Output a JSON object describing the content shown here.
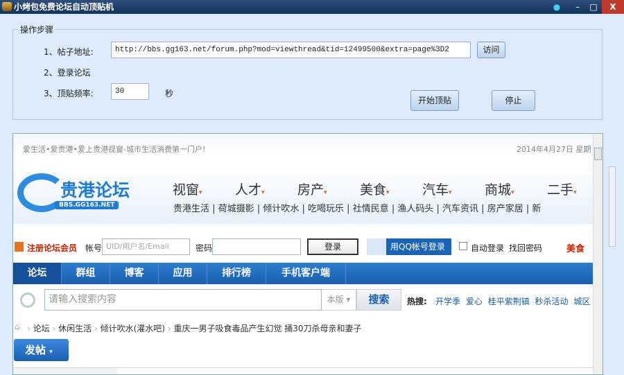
{
  "window": {
    "title": "小烤包免费论坛自动顶贴机",
    "min": "–",
    "max": "□",
    "close": "X"
  },
  "steps": {
    "group_title": "操作步骤",
    "step1_label": "1、帖子地址:",
    "url": "http://bbs.gg163.net/forum.php?mod=viewthread&tid=12499500&extra=page%3D2",
    "visit": "访问",
    "step2_label": "2、登录论坛",
    "step3_label": "3、顶贴频率:",
    "interval": "30",
    "unit": "秒",
    "start": "开始顶贴",
    "stop": "停止"
  },
  "site": {
    "slogan": "爱生活•爱贵港•爱上贵港视窗-城市生活消费第一门户!",
    "date": "2014年4月27日 星期",
    "logo_text": "贵港论坛",
    "logo_sub": "BBS.GG163.NET",
    "main_nav": [
      "视窗",
      "人才",
      "房产",
      "美食",
      "汽车",
      "商城",
      "二手"
    ],
    "sub_nav": [
      "贵港生活",
      "荷城摄影",
      "倾计吹水",
      "吃喝玩乐",
      "社情民意",
      "渔人码头",
      "汽车资讯",
      "房产家居",
      "新"
    ],
    "login": {
      "register": "注册论坛会员",
      "account_label": "帐号",
      "account_placeholder": "UID/用户名/Email",
      "password_label": "密码",
      "login_btn": "登录",
      "qq_login": "用QQ帐号登录",
      "auto_login": "自动登录",
      "find_pwd": "找回密码",
      "promo": "美食"
    },
    "tabs": [
      "论坛",
      "群组",
      "博客",
      "应用",
      "排行榜",
      "手机客户端"
    ],
    "search": {
      "placeholder": "请输入搜索内容",
      "scope": "本版",
      "button": "搜索",
      "hot_label": "热搜:",
      "hot": [
        "开学季",
        "爱心",
        "桂平紫荆镇",
        "秒杀活动",
        "城区"
      ]
    },
    "breadcrumb": [
      "论坛",
      "休闲生活",
      "倾计吹水(灌水吧)",
      "重庆一男子吸食毒品产生幻觉 捅30刀杀母亲和妻子"
    ],
    "post_btn": "发帖"
  },
  "colors": {
    "titlebar": "#1d3d66",
    "accent": "#1a5fae",
    "register": "#cc2200"
  }
}
